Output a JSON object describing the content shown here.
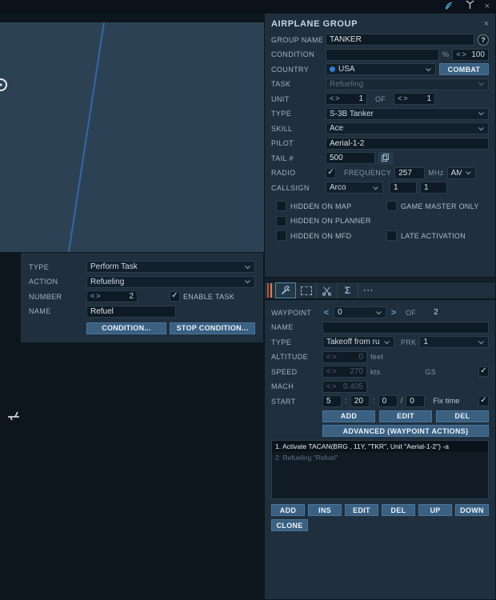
{
  "icons": {
    "help": "?",
    "close": "×",
    "check": "✓",
    "spin_left": "<",
    "spin_right": ">",
    "sigma": "Σ",
    "more": "···"
  },
  "group_panel": {
    "title": "AIRPLANE GROUP",
    "group_name": {
      "label": "GROUP NAME",
      "value": "TANKER"
    },
    "condition": {
      "label": "CONDITION",
      "value": "",
      "percent": "%",
      "amount": "100"
    },
    "country": {
      "label": "COUNTRY",
      "value": "USA",
      "combat_label": "COMBAT"
    },
    "task": {
      "label": "TASK",
      "value": "Refueling"
    },
    "unit": {
      "label": "UNIT",
      "count": "1",
      "of_label": "OF",
      "total": "1"
    },
    "type": {
      "label": "TYPE",
      "value": "S-3B Tanker"
    },
    "skill": {
      "label": "SKILL",
      "value": "Ace"
    },
    "pilot": {
      "label": "PILOT",
      "value": "Aerial-1-2"
    },
    "tail": {
      "label": "TAIL #",
      "value": "500"
    },
    "radio": {
      "label": "RADIO",
      "frequency_label": "FREQUENCY",
      "frequency": "257",
      "unit": "MHz",
      "modulation": "AM"
    },
    "callsign": {
      "label": "CALLSIGN",
      "value": "Arco",
      "flight": "1",
      "number": "1"
    },
    "checkboxes": {
      "hidden_map": "HIDDEN ON MAP",
      "game_master": "GAME MASTER ONLY",
      "hidden_planner": "HIDDEN ON PLANNER",
      "hidden_mfd": "HIDDEN ON MFD",
      "late_activation": "LATE ACTIVATION"
    }
  },
  "task_panel": {
    "type": {
      "label": "TYPE",
      "value": "Perform Task"
    },
    "action": {
      "label": "ACTION",
      "value": "Refueling"
    },
    "number": {
      "label": "NUMBER",
      "value": "2",
      "enable_label": "ENABLE TASK"
    },
    "name": {
      "label": "NAME",
      "value": "Refuel"
    },
    "condition_label": "CONDITION...",
    "stop_condition_label": "STOP CONDITION..."
  },
  "waypoint_panel": {
    "waypoint": {
      "label": "WAYPOINT",
      "value": "0",
      "of_label": "OF",
      "total": "2"
    },
    "name": {
      "label": "NAME",
      "value": ""
    },
    "type": {
      "label": "TYPE",
      "value": "Takeoff from run",
      "prk_label": "PRK",
      "prk_value": "1"
    },
    "altitude": {
      "label": "ALTITUDE",
      "value": "0",
      "unit": "feet"
    },
    "speed": {
      "label": "SPEED",
      "value": "270",
      "unit": "kts",
      "gs_label": "GS"
    },
    "mach": {
      "label": "MACH",
      "value": "0.405"
    },
    "start": {
      "label": "START",
      "hours": "5",
      "minutes": "20",
      "seconds": "0",
      "sep": ":",
      "slash": "/",
      "day": "0",
      "fix_label": "Fix time"
    },
    "add_label": "ADD",
    "edit_label": "EDIT",
    "del_label": "DEL",
    "advanced_label": "ADVANCED (WAYPOINT ACTIONS)",
    "actions": [
      {
        "text": "1. Activate TACAN(BRG , 11Y, \"TKR\", Unit \"Aerial-1-2\")  -a"
      },
      {
        "text": "2. Refueling \"Refuel\""
      }
    ],
    "list_buttons": [
      "ADD",
      "INS",
      "EDIT",
      "DEL",
      "UP",
      "DOWN"
    ],
    "clone_label": "CLONE"
  }
}
